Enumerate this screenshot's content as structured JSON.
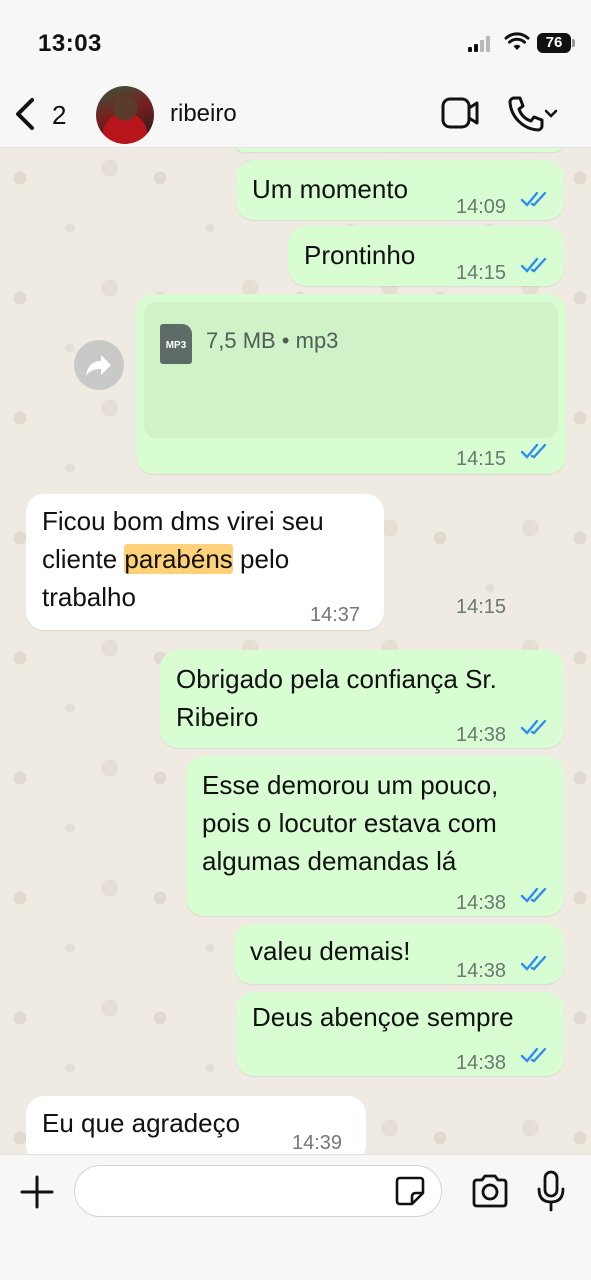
{
  "status_bar": {
    "time": "13:03",
    "battery": "76"
  },
  "header": {
    "back_count": "2",
    "contact_name": "ribeiro"
  },
  "messages": [
    {
      "dir": "out",
      "text": "Um momento",
      "time": "14:09"
    },
    {
      "dir": "out",
      "text": "Prontinho",
      "time": "14:15"
    },
    {
      "dir": "out",
      "type": "file",
      "file_meta": "7,5 MB • mp3",
      "file_type": "MP3",
      "time": "14:15"
    },
    {
      "dir": "in",
      "text_before": "Ficou bom dms virei seu\ncliente ",
      "text_highlight": "parabéns",
      "text_after": " pelo\ntrabalho",
      "time": "14:37"
    },
    {
      "dir": "out",
      "text": "Obrigado pela confiança Sr.\nRibeiro",
      "time": "14:38"
    },
    {
      "dir": "out",
      "text": "Esse demorou um pouco,\npois o locutor estava com\nalgumas demandas lá",
      "time": "14:38"
    },
    {
      "dir": "out",
      "text": "valeu demais!",
      "time": "14:38"
    },
    {
      "dir": "out",
      "text": "Deus abençoe sempre",
      "time": "14:38"
    },
    {
      "dir": "in",
      "text": "Eu que agradeço",
      "time": "14:39"
    }
  ],
  "input": {
    "placeholder": ""
  },
  "colors": {
    "outgoing_bubble": "#d9fdd3",
    "incoming_bubble": "#ffffff",
    "read_ticks": "#2f8cf0",
    "highlight": "#ffd279"
  },
  "icons": [
    "back-chevron-icon",
    "video-call-icon",
    "phone-icon",
    "file-icon",
    "forward-icon",
    "double-check-icon",
    "plus-icon",
    "sticker-icon",
    "camera-icon",
    "microphone-icon"
  ]
}
